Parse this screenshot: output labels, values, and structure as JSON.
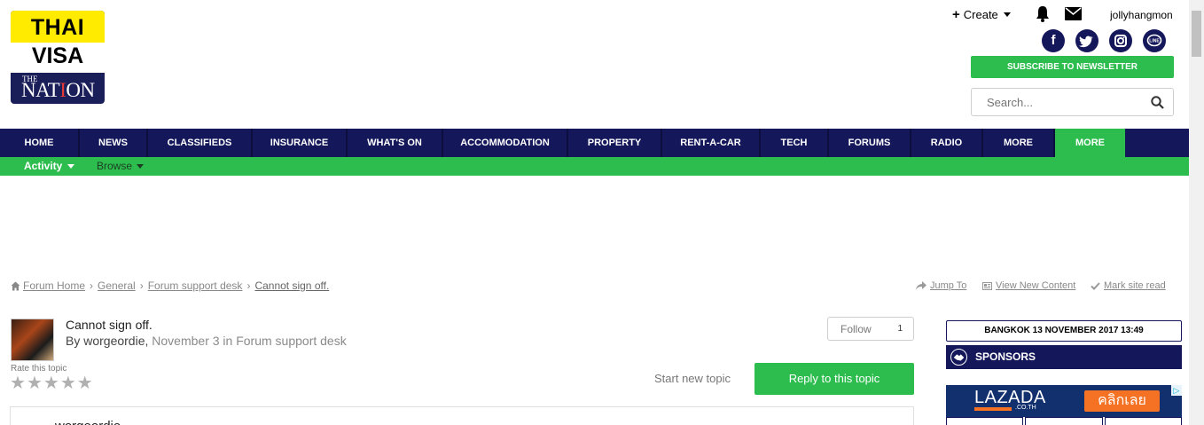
{
  "logo": {
    "line1": "THAI",
    "line2": "VISA",
    "line3_small": "THE",
    "line3_pre": "NAT",
    "line3_red": "I",
    "line3_post": "ON"
  },
  "header": {
    "create_label": "Create",
    "username": "jollyhangmon",
    "social": [
      {
        "name": "facebook",
        "glyph": "f"
      },
      {
        "name": "twitter",
        "glyph": "t"
      },
      {
        "name": "instagram",
        "glyph": "◙"
      },
      {
        "name": "line",
        "glyph": "LINE"
      }
    ],
    "subscribe_label": "SUBSCRIBE TO NEWSLETTER",
    "search_placeholder": "Search..."
  },
  "nav": {
    "items": [
      "HOME",
      "NEWS",
      "CLASSIFIEDS",
      "INSURANCE",
      "WHAT'S ON",
      "ACCOMMODATION",
      "PROPERTY",
      "RENT-A-CAR",
      "TECH",
      "FORUMS",
      "RADIO",
      "MORE",
      "MORE"
    ],
    "active_index": 12
  },
  "subnav": {
    "activity": "Activity",
    "browse": "Browse"
  },
  "breadcrumb": {
    "home": "Forum Home",
    "level1": "General",
    "level2": "Forum support desk",
    "current": "Cannot sign off."
  },
  "actions": {
    "jump_to": "Jump To",
    "view_new": "View New Content",
    "mark_read": "Mark site read"
  },
  "topic": {
    "title": "Cannot sign off.",
    "by": "By worgeordie,",
    "date_forum": "November 3 in Forum support desk",
    "rate_label": "Rate this topic",
    "follow_label": "Follow",
    "follow_count": "1",
    "start_new": "Start new topic",
    "reply": "Reply to this topic",
    "post_author": "worgeordie"
  },
  "sidebar": {
    "date": "BANGKOK 13 NOVEMBER 2017 13:49",
    "sponsors": "SPONSORS",
    "ad": {
      "brand": "LAZADA",
      "domain": ".CO.TH",
      "cta": "คลิกเลย",
      "adchoice": "▷"
    }
  },
  "colors": {
    "navy": "#14175a",
    "green": "#2dbd4e",
    "yellow": "#ffeb00",
    "lazada_orange": "#f57224"
  }
}
